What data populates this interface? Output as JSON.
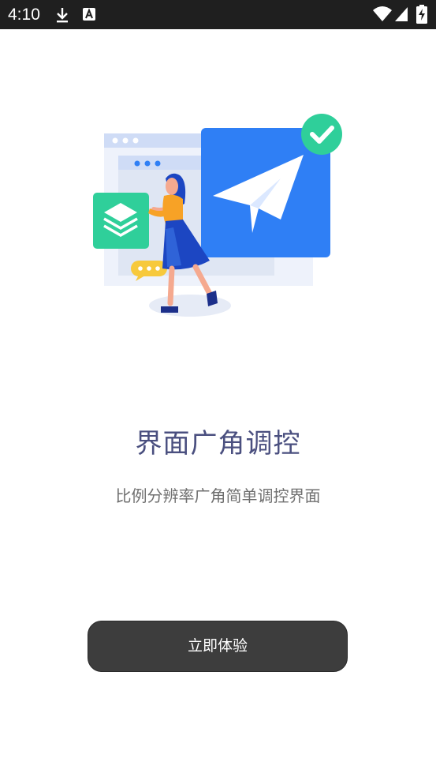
{
  "status_bar": {
    "time": "4:10",
    "left_icons": [
      "download-icon",
      "font-a-icon"
    ],
    "right_icons": [
      "wifi-icon",
      "cellular-signal-icon",
      "battery-charging-icon"
    ]
  },
  "onboarding": {
    "title": "界面广角调控",
    "subtitle": "比例分辨率广角简单调控界面",
    "cta_label": "立即体验"
  },
  "colors": {
    "status_bar_bg": "#1f1f1f",
    "title": "#4a4f7f",
    "subtitle": "#6f6f6f",
    "button_bg": "#3d3d3d",
    "accent_blue": "#2f7ff5",
    "accent_green": "#2fcf9a"
  }
}
